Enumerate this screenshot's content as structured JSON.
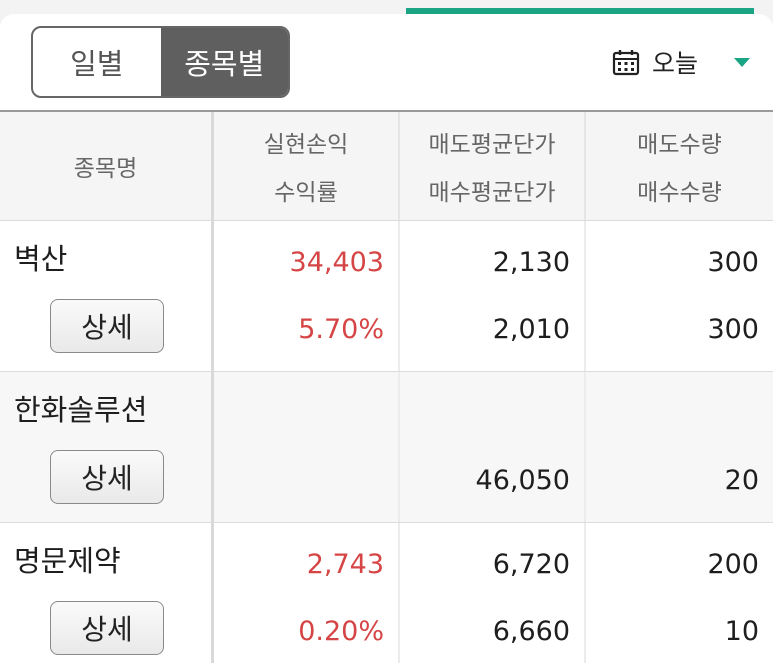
{
  "tabs": {
    "daily": "일별",
    "by_stock": "종목별"
  },
  "date_filter": {
    "label": "오늘"
  },
  "colors": {
    "accent": "#1aa584",
    "profit": "#d64545",
    "tab_active": "#5f5f5f"
  },
  "header": {
    "stock_name": "종목명",
    "realized_pl": "실현손익",
    "return_rate": "수익률",
    "avg_sell_price": "매도평균단가",
    "avg_buy_price": "매수평균단가",
    "sell_qty": "매도수량",
    "buy_qty": "매수수량"
  },
  "rows": [
    {
      "name": "벽산",
      "detail": "상세",
      "realized_pl": "34,403",
      "return_rate": "5.70%",
      "avg_sell": "2,130",
      "avg_buy": "2,010",
      "sell_qty": "300",
      "buy_qty": "300"
    },
    {
      "name": "한화솔루션",
      "detail": "상세",
      "realized_pl": "",
      "return_rate": "",
      "avg_sell": "",
      "avg_buy": "46,050",
      "sell_qty": "",
      "buy_qty": "20"
    },
    {
      "name": "명문제약",
      "detail": "상세",
      "realized_pl": "2,743",
      "return_rate": "0.20%",
      "avg_sell": "6,720",
      "avg_buy": "6,660",
      "sell_qty": "200",
      "buy_qty": "10"
    }
  ]
}
